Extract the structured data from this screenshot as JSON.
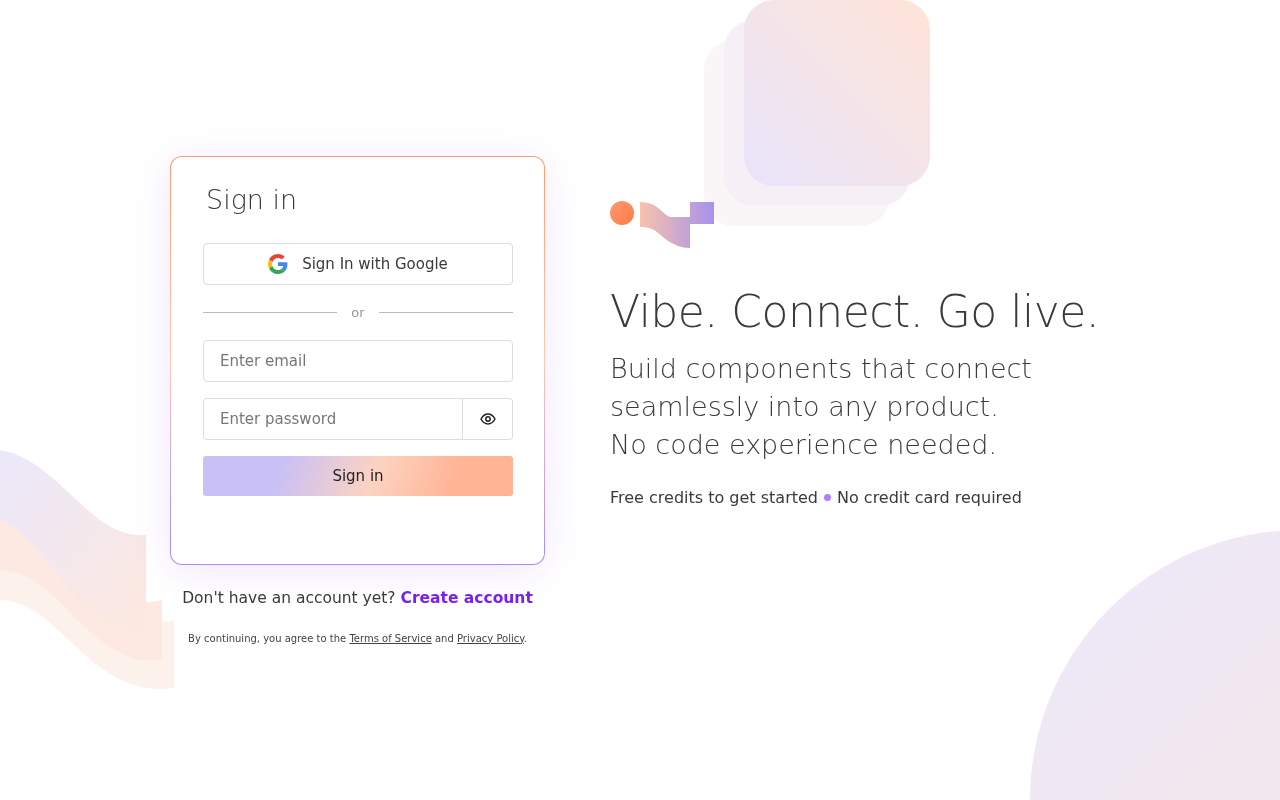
{
  "signin": {
    "title": "Sign in",
    "google_button": "Sign In with Google",
    "divider": "or",
    "email": {
      "placeholder": "Enter email"
    },
    "password": {
      "placeholder": "Enter password"
    },
    "submit": "Sign in"
  },
  "signup": {
    "prompt": "Don't have an account yet?",
    "link": "Create account"
  },
  "legal": {
    "prefix": "By continuing, you agree to the",
    "terms": "Terms of Service",
    "joiner": "and",
    "privacy": "Privacy Policy",
    "suffix": "."
  },
  "hero": {
    "headline": "Vibe. Connect. Go live.",
    "subtitle_lines": [
      "Build components that connect seamlessly into any product.",
      "No code experience needed."
    ],
    "features": [
      "Free credits to get started",
      "No credit card required"
    ]
  }
}
